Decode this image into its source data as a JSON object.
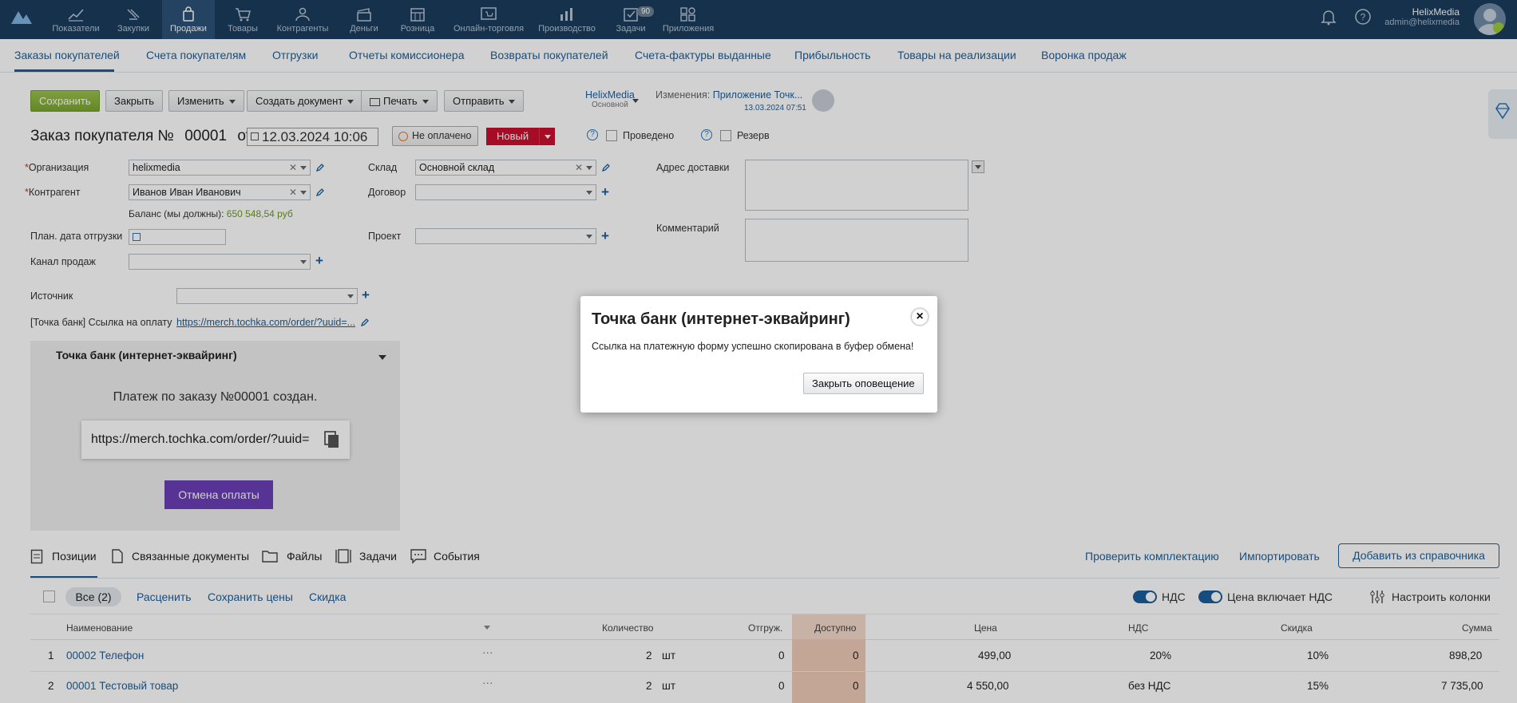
{
  "topnav": {
    "items": [
      {
        "label": "Показатели",
        "icon": "chart-icon"
      },
      {
        "label": "Закупки",
        "icon": "purchases-icon"
      },
      {
        "label": "Продажи",
        "icon": "sales-bag-icon"
      },
      {
        "label": "Товары",
        "icon": "cart-icon"
      },
      {
        "label": "Контрагенты",
        "icon": "contacts-icon"
      },
      {
        "label": "Деньги",
        "icon": "money-icon"
      },
      {
        "label": "Розница",
        "icon": "store-icon"
      },
      {
        "label": "Онлайн-торговля",
        "icon": "online-shop-icon"
      },
      {
        "label": "Производство",
        "icon": "production-icon"
      },
      {
        "label": "Задачи",
        "icon": "tasks-icon",
        "badge": "90"
      },
      {
        "label": "Приложения",
        "icon": "apps-icon"
      }
    ],
    "user_name": "HelixMedia",
    "user_email": "admin@helixmedia"
  },
  "tabs": [
    "Заказы покупателей",
    "Счета покупателям",
    "Отгрузки",
    "Отчеты комиссионера",
    "Возвраты покупателей",
    "Счета-фактуры выданные",
    "Прибыльность",
    "Товары на реализации",
    "Воронка продаж"
  ],
  "toolbar": {
    "save": "Сохранить",
    "close": "Закрыть",
    "edit": "Изменить",
    "create_doc": "Создать документ",
    "print": "Печать",
    "send": "Отправить",
    "org_name": "HelixMedia",
    "org_sub": "Основной",
    "changes_label": "Изменения:",
    "changes_link": "Приложение Точк...",
    "changes_date": "13.03.2024 07:51"
  },
  "header": {
    "title_prefix": "Заказ покупателя №",
    "number": "00001",
    "from": "от",
    "date": "12.03.2024 10:06",
    "payment_status": "Не оплачено",
    "state": "Новый",
    "posted": "Проведено",
    "reserve": "Резерв",
    "help": "?"
  },
  "form": {
    "org_label": "Организация",
    "org_value": "helixmedia",
    "counterparty_label": "Контрагент",
    "counterparty_value": "Иванов Иван Иванович",
    "balance_label": "Баланс (мы должны):",
    "balance_value": "650 548,54 руб",
    "ship_date_label": "План. дата отгрузки",
    "channel_label": "Канал продаж",
    "warehouse_label": "Склад",
    "warehouse_value": "Основной склад",
    "contract_label": "Договор",
    "project_label": "Проект",
    "address_label": "Адрес доставки",
    "comment_label": "Комментарий",
    "source_label": "Источник",
    "paylink_label": "[Точка банк] Ссылка на оплату",
    "paylink_value": "https://merch.tochka.com/order/?uuid=..."
  },
  "panel": {
    "title": "Точка банк (интернет-эквайринг)",
    "created_text": "Платеж по заказу №00001 создан.",
    "url": "https://merch.tochka.com/order/?uuid=",
    "cancel_button": "Отмена оплаты"
  },
  "bottom": {
    "tabs": [
      "Позиции",
      "Связанные документы",
      "Файлы",
      "Задачи",
      "События"
    ],
    "check_kit": "Проверить комплектацию",
    "import": "Импортировать",
    "add_from_catalog": "Добавить из справочника",
    "all_filter": "Все (2)",
    "reprice": "Расценить",
    "save_prices": "Сохранить цены",
    "discount": "Скидка",
    "vat_toggle": "НДС",
    "price_incl_vat": "Цена включает НДС",
    "configure_columns": "Настроить колонки"
  },
  "table": {
    "headers": {
      "name": "Наименование",
      "more": "···",
      "qty": "Количество",
      "shipped": "Отгруж.",
      "available": "Доступно",
      "price": "Цена",
      "vat": "НДС",
      "discount": "Скидка",
      "sum": "Сумма"
    },
    "rows": [
      {
        "n": "1",
        "name": "00002 Телефон",
        "qty": "2",
        "unit": "шт",
        "shipped": "0",
        "available": "0",
        "price": "499,00",
        "vat": "20%",
        "discount": "10%",
        "sum": "898,20"
      },
      {
        "n": "2",
        "name": "00001 Тестовый товар",
        "qty": "2",
        "unit": "шт",
        "shipped": "0",
        "available": "0",
        "price": "4 550,00",
        "vat": "без НДС",
        "discount": "15%",
        "sum": "7 735,00"
      }
    ]
  },
  "modal": {
    "title": "Точка банк (интернет-эквайринг)",
    "message": "Ссылка на платежную форму успешно скопирована в буфер обмена!",
    "close_button": "Закрыть оповещение",
    "close_icon": "×"
  },
  "colors": {
    "topbar": "#1a3c5c",
    "link": "#1d5f9a",
    "save_green": "#86b038",
    "state_red": "#c8102e",
    "cancel_purple": "#6a3fb5",
    "available_cell": "#f0cbb8"
  }
}
